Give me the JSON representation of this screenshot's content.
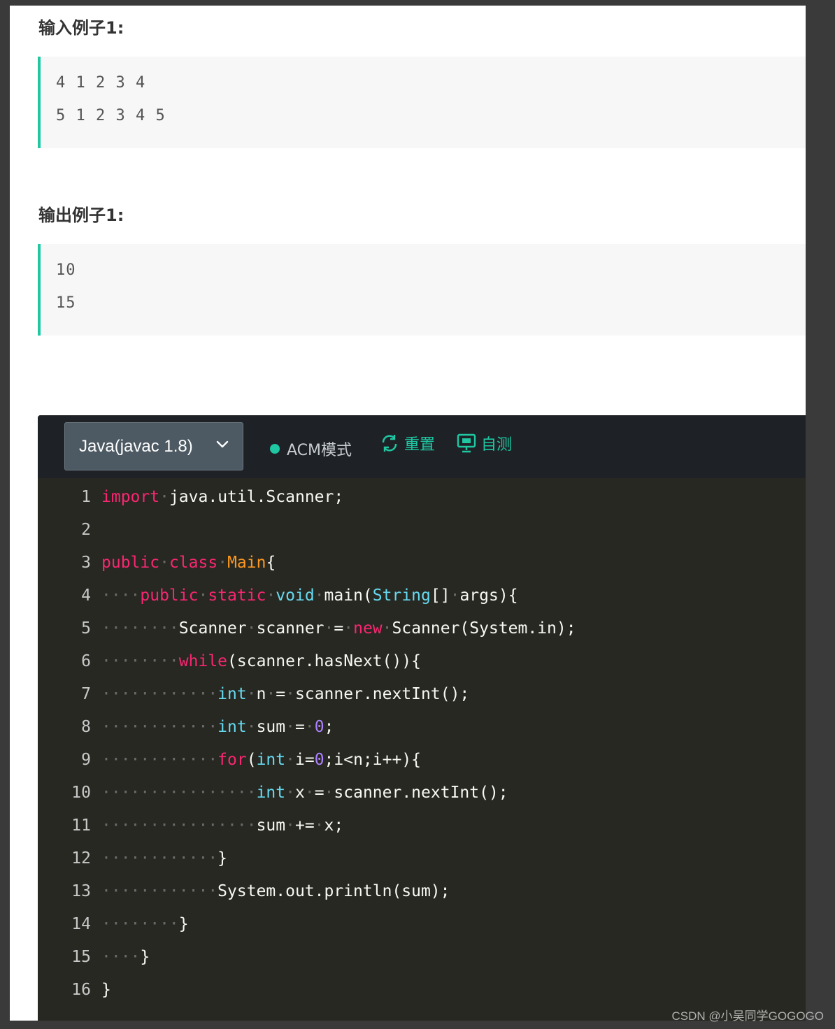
{
  "input_sample": {
    "title": "输入例子1:",
    "lines": [
      "4 1 2 3 4",
      "5 1 2 3 4 5"
    ]
  },
  "output_sample": {
    "title": "输出例子1:",
    "lines": [
      "10",
      "15"
    ]
  },
  "editor": {
    "language": "Java(javac 1.8)",
    "mode_label": "ACM模式",
    "reset_label": "重置",
    "self_test_label": "自测",
    "accent_color": "#1fc7a3",
    "lines": [
      {
        "n": "1",
        "indent": 0,
        "tokens": [
          [
            "kw",
            "import"
          ],
          [
            "ws",
            "·"
          ],
          [
            "t",
            "java.util.Scanner;"
          ]
        ]
      },
      {
        "n": "2",
        "indent": 0,
        "tokens": []
      },
      {
        "n": "3",
        "indent": 0,
        "tokens": [
          [
            "kw",
            "public"
          ],
          [
            "ws",
            "·"
          ],
          [
            "kw",
            "class"
          ],
          [
            "ws",
            "·"
          ],
          [
            "cls",
            "Main"
          ],
          [
            "t",
            "{"
          ]
        ]
      },
      {
        "n": "4",
        "indent": 4,
        "tokens": [
          [
            "kw",
            "public"
          ],
          [
            "ws",
            "·"
          ],
          [
            "kw",
            "static"
          ],
          [
            "ws",
            "·"
          ],
          [
            "ty",
            "void"
          ],
          [
            "ws",
            "·"
          ],
          [
            "t",
            "main("
          ],
          [
            "ty",
            "String"
          ],
          [
            "t",
            "[]"
          ],
          [
            "ws",
            "·"
          ],
          [
            "t",
            "args){"
          ]
        ]
      },
      {
        "n": "5",
        "indent": 8,
        "tokens": [
          [
            "t",
            "Scanner"
          ],
          [
            "ws",
            "·"
          ],
          [
            "t",
            "scanner"
          ],
          [
            "ws",
            "·"
          ],
          [
            "t",
            "="
          ],
          [
            "ws",
            "·"
          ],
          [
            "kw",
            "new"
          ],
          [
            "ws",
            "·"
          ],
          [
            "t",
            "Scanner(System.in);"
          ]
        ]
      },
      {
        "n": "6",
        "indent": 8,
        "tokens": [
          [
            "kw",
            "while"
          ],
          [
            "t",
            "(scanner.hasNext()){"
          ]
        ]
      },
      {
        "n": "7",
        "indent": 12,
        "tokens": [
          [
            "ty",
            "int"
          ],
          [
            "ws",
            "·"
          ],
          [
            "t",
            "n"
          ],
          [
            "ws",
            "·"
          ],
          [
            "t",
            "="
          ],
          [
            "ws",
            "·"
          ],
          [
            "t",
            "scanner.nextInt();"
          ]
        ]
      },
      {
        "n": "8",
        "indent": 12,
        "tokens": [
          [
            "ty",
            "int"
          ],
          [
            "ws",
            "·"
          ],
          [
            "t",
            "sum"
          ],
          [
            "ws",
            "·"
          ],
          [
            "t",
            "="
          ],
          [
            "ws",
            "·"
          ],
          [
            "num",
            "0"
          ],
          [
            "t",
            ";"
          ]
        ]
      },
      {
        "n": "9",
        "indent": 12,
        "tokens": [
          [
            "kw",
            "for"
          ],
          [
            "t",
            "("
          ],
          [
            "ty",
            "int"
          ],
          [
            "ws",
            "·"
          ],
          [
            "t",
            "i="
          ],
          [
            "num",
            "0"
          ],
          [
            "t",
            ";i<n;i++){"
          ]
        ]
      },
      {
        "n": "10",
        "indent": 16,
        "tokens": [
          [
            "ty",
            "int"
          ],
          [
            "ws",
            "·"
          ],
          [
            "t",
            "x"
          ],
          [
            "ws",
            "·"
          ],
          [
            "t",
            "="
          ],
          [
            "ws",
            "·"
          ],
          [
            "t",
            "scanner.nextInt();"
          ]
        ]
      },
      {
        "n": "11",
        "indent": 16,
        "tokens": [
          [
            "t",
            "sum"
          ],
          [
            "ws",
            "·"
          ],
          [
            "t",
            "+="
          ],
          [
            "ws",
            "·"
          ],
          [
            "t",
            "x;"
          ]
        ]
      },
      {
        "n": "12",
        "indent": 12,
        "tokens": [
          [
            "t",
            "}"
          ]
        ]
      },
      {
        "n": "13",
        "indent": 12,
        "tokens": [
          [
            "t",
            "System.out.println(sum);"
          ]
        ]
      },
      {
        "n": "14",
        "indent": 8,
        "tokens": [
          [
            "t",
            "}"
          ]
        ]
      },
      {
        "n": "15",
        "indent": 4,
        "tokens": [
          [
            "t",
            "}"
          ]
        ]
      },
      {
        "n": "16",
        "indent": 0,
        "tokens": [
          [
            "t",
            "}"
          ]
        ]
      }
    ]
  },
  "watermark": "CSDN @小吴同学GOGOGO"
}
